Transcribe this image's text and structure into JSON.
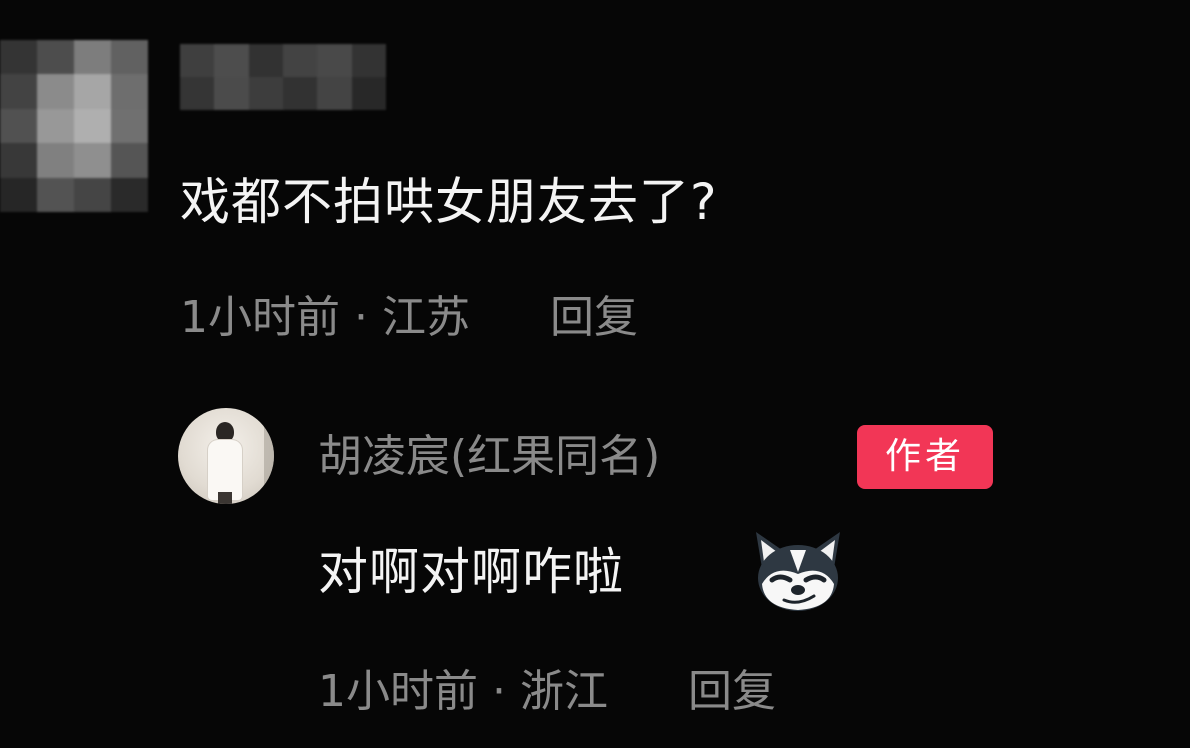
{
  "comment": {
    "text": "戏都不拍哄女朋友去了?",
    "time": "1小时前",
    "separator": "·",
    "location": "江苏",
    "reply_label": "回复"
  },
  "reply": {
    "author_name": "胡凌宸(红果同名)",
    "author_badge": "作者",
    "text": "对啊对啊咋啦",
    "emoji_icon": "smirking-husky-emoji",
    "time": "1小时前",
    "separator": "·",
    "location": "浙江",
    "reply_label": "回复"
  },
  "colors": {
    "background": "#060606",
    "primary_text": "#f4f4f4",
    "secondary_text": "#8a8a8a",
    "badge": "#f23656"
  }
}
